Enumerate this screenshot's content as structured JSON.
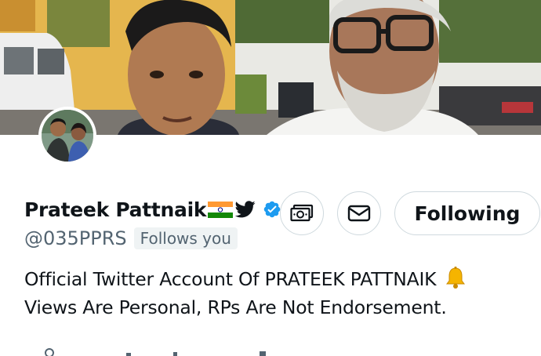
{
  "profile": {
    "display_name": "Prateek Pattnaik",
    "handle": "@035PPRS",
    "follows_you_label": "Follows you",
    "bio_line1": "Official Twitter Account Of PRATEEK PATTNAIK",
    "bio_line2": "Views Are Personal, RPs Are Not Endorsement.",
    "name_badges": [
      "india-flag-icon",
      "twitter-bird-icon",
      "verified-badge-icon"
    ],
    "bio_emoji": "bell-icon"
  },
  "actions": {
    "following_label": "Following",
    "subscribe_icon": "money-icon",
    "message_icon": "envelope-icon"
  },
  "colors": {
    "verified": "#1d9bf0",
    "text_primary": "#0f1419",
    "text_secondary": "#536471",
    "button_border": "#cfd9de",
    "badge_bg": "#eff3f4"
  }
}
